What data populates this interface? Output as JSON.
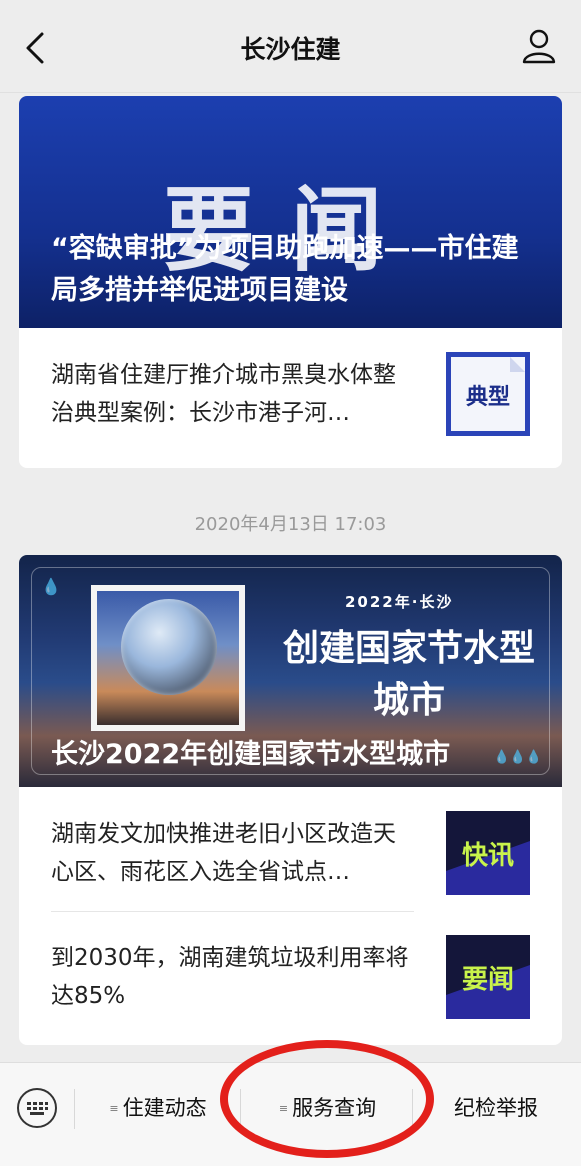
{
  "nav": {
    "title": "长沙住建"
  },
  "card1": {
    "banner_big": "要闻",
    "banner_caption": "“容缺审批”为项目助跑加速——市住建局多措并举促进项目建设",
    "item": {
      "title": "湖南省住建厅推介城市黑臭水体整治典型案例：长沙市港子河…",
      "thumb_text": "典型"
    }
  },
  "timestamp": "2020年4月13日 17:03",
  "card2": {
    "banner_top": "2022年·长沙",
    "banner_mid": "创建国家节水型城市",
    "banner_caption": "长沙2022年创建国家节水型城市",
    "items": [
      {
        "title": "湖南发文加快推进老旧小区改造天心区、雨花区入选全省试点…",
        "thumb_text": "快讯"
      },
      {
        "title": "到2030年，湖南建筑垃圾利用率将达85%",
        "thumb_text": "要闻"
      }
    ]
  },
  "footer": {
    "menus": [
      {
        "label": "住建动态"
      },
      {
        "label": "服务查询"
      },
      {
        "label": "纪检举报"
      }
    ]
  },
  "colors": {
    "accent_red": "#e3201b",
    "banner_blue": "#1c3fb0"
  }
}
